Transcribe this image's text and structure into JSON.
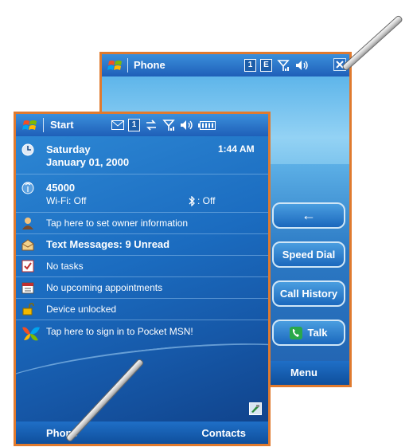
{
  "phone_window": {
    "title": "Phone",
    "status_icons": [
      "sim-1-icon",
      "e-network-icon",
      "signal-icon",
      "speaker-icon",
      "close-icon"
    ],
    "sim_label": "1",
    "network_label": "E",
    "buttons": [
      {
        "label": "←",
        "icon": "backspace-icon"
      },
      {
        "label": "Speed Dial"
      },
      {
        "label": "Call History"
      },
      {
        "label": "Talk",
        "icon": "phone-handset-icon"
      }
    ],
    "menu_label": "Menu"
  },
  "today_window": {
    "title": "Start",
    "sim_label": "1",
    "date_day": "Saturday",
    "date_full": "January 01, 2000",
    "time": "1:44 AM",
    "carrier": "45000",
    "wifi": "Wi-Fi: Off",
    "bluetooth": ": Off",
    "owner": "Tap here to set owner information",
    "messages": "Text Messages: 9 Unread",
    "tasks": "No tasks",
    "appointments": "No upcoming appointments",
    "device": "Device unlocked",
    "msn": "Tap here to sign in to Pocket MSN!",
    "softkey_left": "Phone",
    "softkey_right": "Contacts"
  },
  "colors": {
    "window_border": "#e07a2e",
    "titlebar": "#1f5fb8",
    "today_bg": "#1b6cc0",
    "phone_bg": "#62b6ea"
  }
}
